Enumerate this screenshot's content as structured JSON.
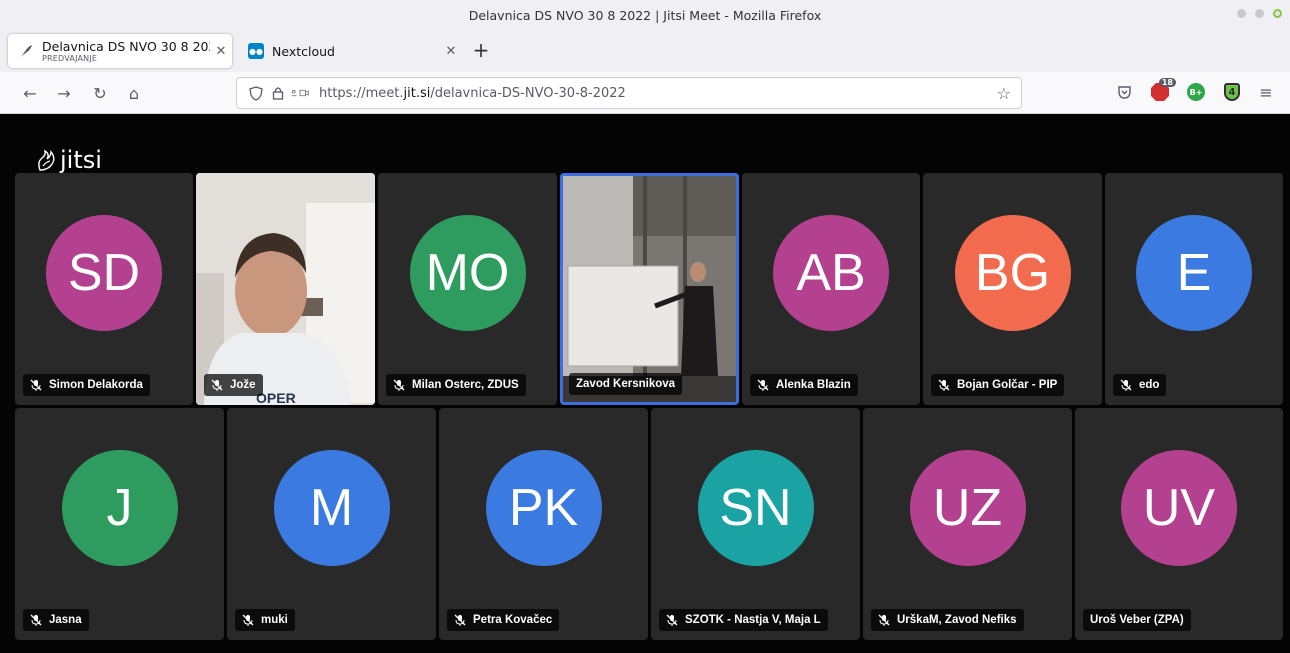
{
  "window": {
    "title": "Delavnica DS NVO 30 8 2022 | Jitsi Meet - Mozilla Firefox"
  },
  "tabs": [
    {
      "title": "Delavnica DS NVO 30 8 2022",
      "subtitle": "PREDVAJANJE",
      "active": true
    },
    {
      "title": "Nextcloud",
      "active": false
    }
  ],
  "navbar": {
    "url_prefix": "https://meet.",
    "url_domain": "jit.si",
    "url_path": "/delavnica-DS-NVO-30-8-2022",
    "extensions": [
      {
        "name": "pocket-icon"
      },
      {
        "name": "abp-icon",
        "badge": "18"
      },
      {
        "name": "b-plus-icon",
        "text": "B+"
      },
      {
        "name": "shield-4-icon",
        "text": "4"
      },
      {
        "name": "menu-icon"
      }
    ]
  },
  "meeting": {
    "logo_text": "jitsi",
    "row1": [
      {
        "name": "Simon Delakorda",
        "initials": "SD",
        "color": "#b4418f",
        "muted": true,
        "video": false
      },
      {
        "name": "Jože",
        "initials": "",
        "color": "",
        "muted": true,
        "video": true
      },
      {
        "name": "Milan Osterc, ZDUS",
        "initials": "MO",
        "color": "#2e9c5e",
        "muted": true,
        "video": false
      },
      {
        "name": "Zavod Kersnikova",
        "initials": "",
        "color": "",
        "muted": false,
        "video": true,
        "dominant": true
      },
      {
        "name": "Alenka Blazin",
        "initials": "AB",
        "color": "#b4418f",
        "muted": true,
        "video": false
      },
      {
        "name": "Bojan Golčar - PIP",
        "initials": "BG",
        "color": "#f36b4f",
        "muted": true,
        "video": false
      },
      {
        "name": "edo",
        "initials": "E",
        "color": "#3b7ae0",
        "muted": true,
        "video": false
      }
    ],
    "row2": [
      {
        "name": "Jasna",
        "initials": "J",
        "color": "#2e9c5e",
        "muted": true
      },
      {
        "name": "muki",
        "initials": "M",
        "color": "#3b7ae0",
        "muted": true
      },
      {
        "name": "Petra Kovačec",
        "initials": "PK",
        "color": "#3b7ae0",
        "muted": true
      },
      {
        "name": "SZOTK - Nastja V, Maja L",
        "initials": "SN",
        "color": "#1ba3a3",
        "muted": true
      },
      {
        "name": "UrškaM, Zavod Nefiks",
        "initials": "UZ",
        "color": "#b4418f",
        "muted": true
      },
      {
        "name": "Uroš Veber (ZPA)",
        "initials": "UV",
        "color": "#b4418f",
        "muted": false
      }
    ]
  }
}
